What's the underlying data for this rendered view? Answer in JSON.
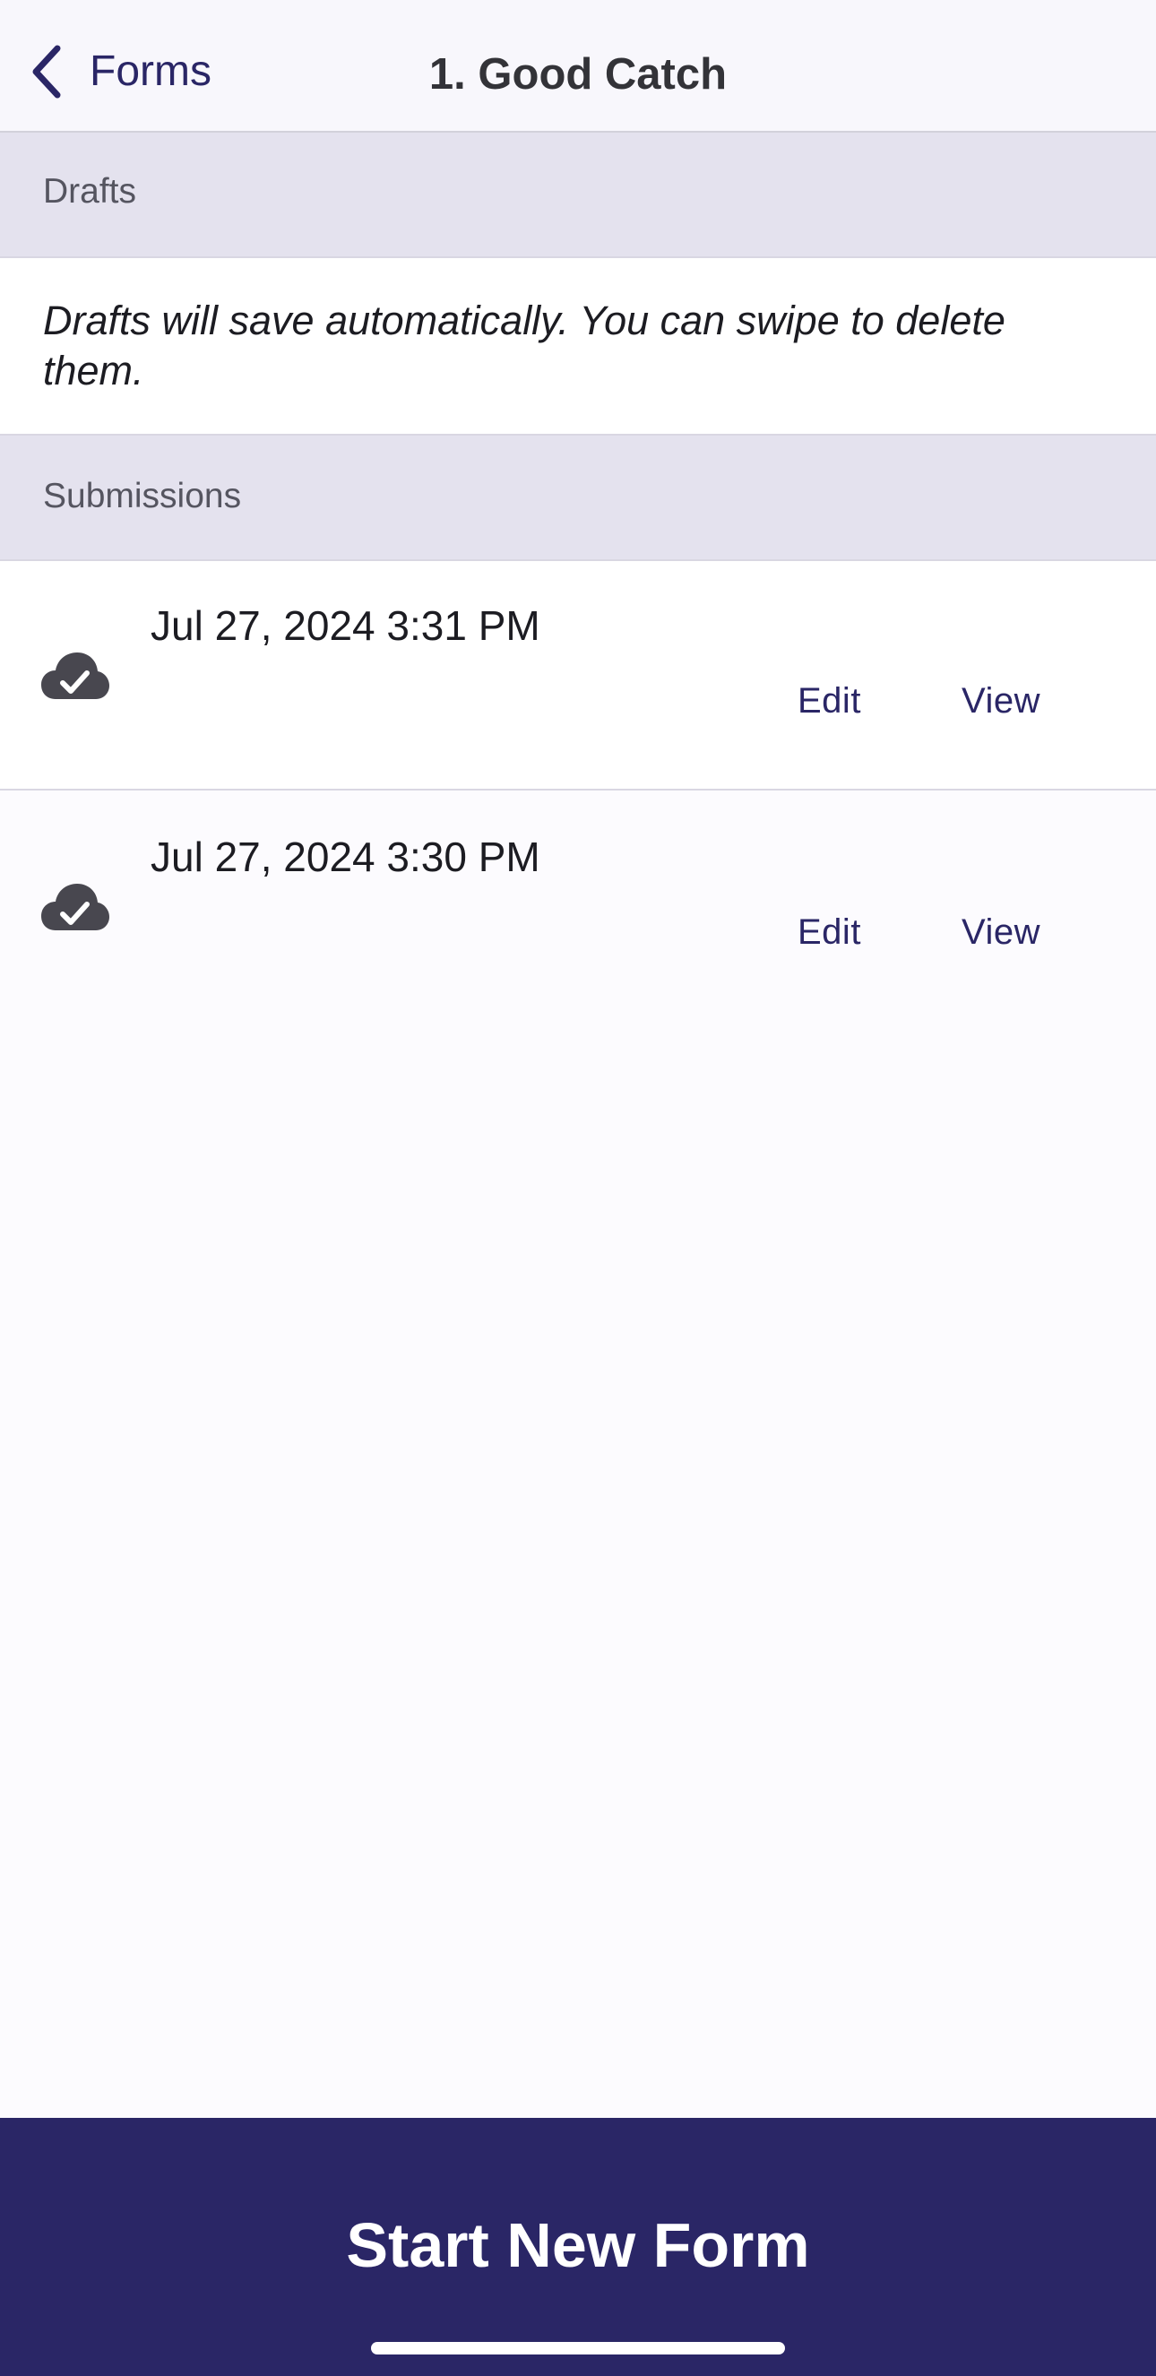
{
  "nav": {
    "back_label": "Forms",
    "title": "1. Good Catch"
  },
  "drafts": {
    "header": "Drafts",
    "info": "Drafts will save automatically. You can swipe to delete them."
  },
  "submissions": {
    "header": "Submissions",
    "items": [
      {
        "date": "Jul 27, 2024 3:31 PM",
        "edit_label": "Edit",
        "view_label": "View",
        "icon": "cloud-check-icon"
      },
      {
        "date": "Jul 27, 2024 3:30 PM",
        "edit_label": "Edit",
        "view_label": "View",
        "icon": "cloud-check-icon"
      }
    ]
  },
  "footer": {
    "start_label": "Start New Form"
  },
  "colors": {
    "accent": "#2a2666",
    "section_bg": "#e4e2ee",
    "icon": "#48474f"
  }
}
